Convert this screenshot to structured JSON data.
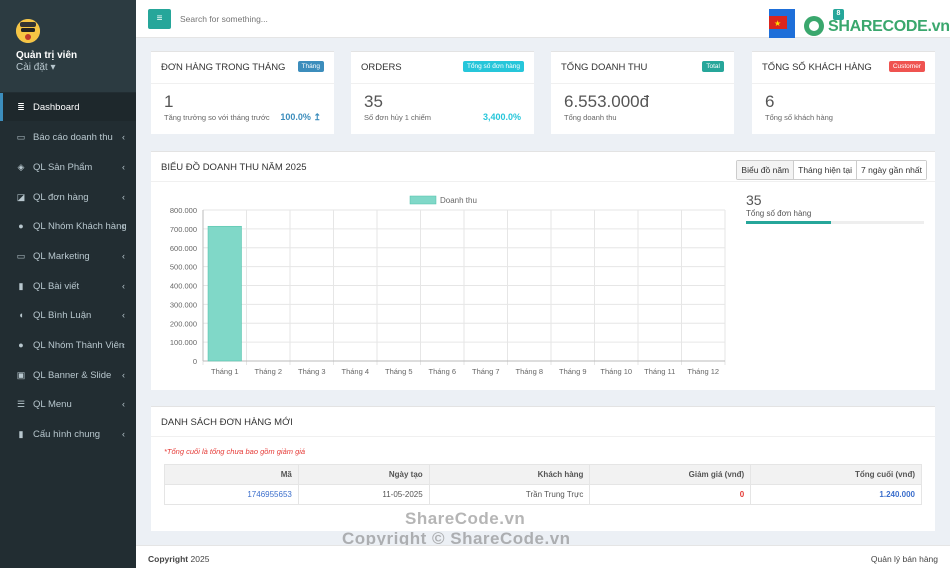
{
  "sidebar": {
    "user_name": "Quản trị viên",
    "user_settings": "Cài đặt",
    "items": [
      {
        "label": "Dashboard",
        "icon": "database-icon"
      },
      {
        "label": "Báo cáo doanh thu",
        "icon": "money-icon"
      },
      {
        "label": "QL Sản Phẩm",
        "icon": "cube-icon"
      },
      {
        "label": "QL đơn hàng",
        "icon": "bag-icon"
      },
      {
        "label": "QL Nhóm Khách hàng",
        "icon": "user-icon"
      },
      {
        "label": "QL Marketing",
        "icon": "money-icon"
      },
      {
        "label": "QL Bài viết",
        "icon": "file-icon"
      },
      {
        "label": "QL Bình Luận",
        "icon": "comment-icon"
      },
      {
        "label": "QL Nhóm Thành Viên",
        "icon": "user-icon"
      },
      {
        "label": "QL Banner & Slide",
        "icon": "image-icon"
      },
      {
        "label": "QL Menu",
        "icon": "list-icon"
      },
      {
        "label": "Cấu hình chung",
        "icon": "file-icon"
      }
    ]
  },
  "topbar": {
    "search_placeholder": "Search for something...",
    "notification_count": "8",
    "logo_text": "SHARECODE.vn"
  },
  "stats": [
    {
      "title": "ĐƠN HÀNG TRONG THÁNG",
      "badge": "Tháng",
      "badge_color": "#3c8dbc",
      "value": "1",
      "desc": "Tăng trưởng so với tháng trước",
      "pct": "100.0%",
      "pct_color": "#3c8dbc"
    },
    {
      "title": "ORDERS",
      "badge": "Tổng số đơn hàng",
      "badge_color": "#26c6da",
      "value": "35",
      "desc": "Số đơn hủy 1 chiếm",
      "pct": "3,400.0%",
      "pct_color": "#26c6da"
    },
    {
      "title": "TỔNG DOANH THU",
      "badge": "Total",
      "badge_color": "#26a69a",
      "value": "6.553.000đ",
      "desc": "Tổng doanh thu"
    },
    {
      "title": "TỔNG SỐ KHÁCH HÀNG",
      "badge": "Customer",
      "badge_color": "#ef5350",
      "value": "6",
      "desc": "Tổng số khách hàng"
    }
  ],
  "chart_section": {
    "title": "BIỂU ĐỒ DOANH THU NĂM 2025",
    "tabs": [
      "Biểu đồ năm",
      "Tháng hiện tại",
      "7 ngày gần nhất"
    ],
    "side_value": "35",
    "side_label": "Tổng số đơn hàng",
    "side_progress": 0.48
  },
  "chart_data": {
    "type": "bar",
    "categories": [
      "Tháng 1",
      "Tháng 2",
      "Tháng 3",
      "Tháng 4",
      "Tháng 5",
      "Tháng 6",
      "Tháng 7",
      "Tháng 8",
      "Tháng 9",
      "Tháng 10",
      "Tháng 11",
      "Tháng 12"
    ],
    "series": [
      {
        "name": "Doanh thu",
        "values": [
          714000,
          0,
          0,
          0,
          0,
          0,
          0,
          0,
          0,
          0,
          0,
          0
        ],
        "color": "#80d8c8"
      }
    ],
    "ylim": [
      0,
      800000
    ],
    "yticks": [
      "0",
      "100.000",
      "200.000",
      "300.000",
      "400.000",
      "500.000",
      "600.000",
      "700.000",
      "800.000"
    ],
    "legend": "top",
    "grid": true
  },
  "orders": {
    "title": "DANH SÁCH ĐƠN HÀNG MỚI",
    "note": "*Tổng cuối là tổng chưa bao gồm giảm giá",
    "columns": [
      "Mã",
      "Ngày tạo",
      "Khách hàng",
      "Giảm giá (vnđ)",
      "Tổng cuối (vnđ)"
    ],
    "rows": [
      [
        "1746955653",
        "11-05-2025",
        "Trần Trung Trực",
        "0",
        "1.240.000"
      ]
    ]
  },
  "footer": {
    "copyright_label": "Copyright",
    "copyright_year": "2025",
    "right": "Quản lý bán hàng"
  },
  "watermark": {
    "line1": "ShareCode.vn",
    "line2": "Copyright © ShareCode.vn"
  }
}
